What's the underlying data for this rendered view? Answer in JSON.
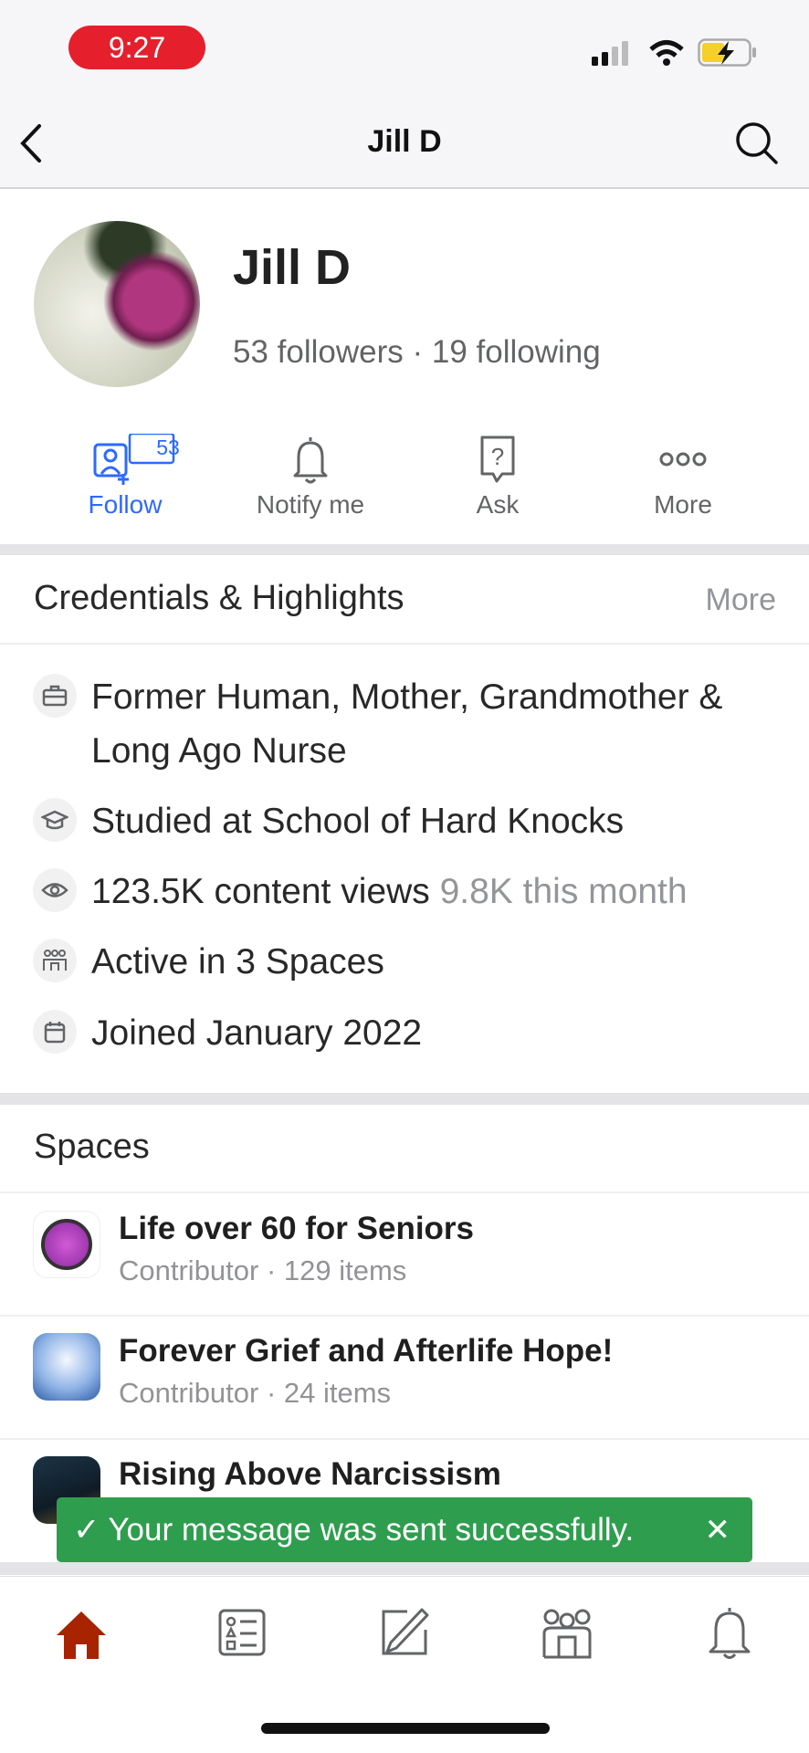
{
  "status_bar": {
    "time": "9:27",
    "icons": [
      "signal-icon",
      "wifi-icon",
      "battery-charging-icon"
    ]
  },
  "nav": {
    "title": "Jill D",
    "back_icon": "chevron-left-icon",
    "search_icon": "search-icon"
  },
  "profile": {
    "name": "Jill D",
    "stats": "53 followers · 19 following"
  },
  "actions": [
    {
      "label": "Follow",
      "badge": "53",
      "icon": "follow-user-icon",
      "color": "#2e69ff"
    },
    {
      "label": "Notify me",
      "icon": "bell-icon"
    },
    {
      "label": "Ask",
      "icon": "question-bubble-icon"
    },
    {
      "label": "More",
      "icon": "more-dots-icon"
    }
  ],
  "credentials": {
    "title": "Credentials & Highlights",
    "more": "More",
    "items": [
      {
        "icon": "briefcase-icon",
        "text": "Former Human, Mother, Grandmother & Long Ago Nurse"
      },
      {
        "icon": "graduation-cap-icon",
        "text": "Studied at School of Hard Knocks"
      },
      {
        "icon": "eye-icon",
        "text": "123.5K content views",
        "extra": "9.8K this month"
      },
      {
        "icon": "spaces-icon",
        "text": "Active in 3 Spaces"
      },
      {
        "icon": "calendar-icon",
        "text": "Joined January 2022"
      }
    ]
  },
  "spaces": {
    "title": "Spaces",
    "items": [
      {
        "name": "Life over 60 for Seniors",
        "meta": "Contributor · 129 items"
      },
      {
        "name": "Forever Grief and Afterlife Hope!",
        "meta": "Contributor · 24 items"
      },
      {
        "name": "Rising Above Narcissism",
        "meta": ""
      }
    ]
  },
  "toast": {
    "message": "✓ Your message was sent successfully.",
    "close": "✕",
    "color": "#2e9e4e"
  },
  "tabbar": {
    "items": [
      "home-icon",
      "following-list-icon",
      "write-icon",
      "spaces-icon",
      "notifications-icon"
    ],
    "active_color": "#a82400"
  }
}
